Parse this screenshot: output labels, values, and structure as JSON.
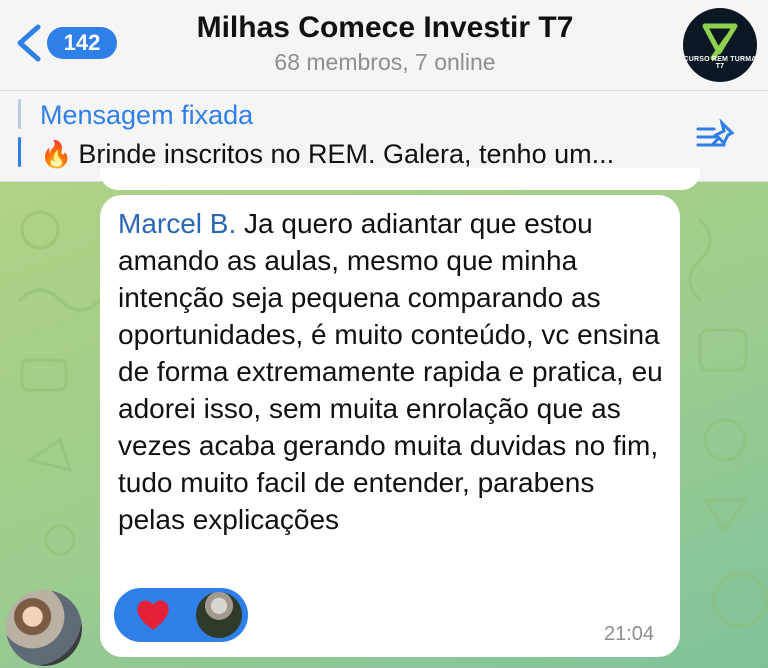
{
  "header": {
    "back_count": "142",
    "title": "Milhas Comece Investir T7",
    "subtitle": "68 membros, 7 online",
    "channel_avatar_text": "CURSO REM TURMA T7"
  },
  "pinned": {
    "label": "Mensagem fixada",
    "emoji": "🔥",
    "text": "Brinde inscritos no REM. Galera, tenho um..."
  },
  "message": {
    "author": "Marcel B.",
    "text": "Ja quero adiantar que estou amando as aulas, mesmo que minha intenção seja pequena comparando as oportunidades, é muito conteúdo, vc ensina de forma extremamente rapida e pratica, eu adorei isso, sem muita enrolação que as vezes acaba gerando muita duvidas no fim, tudo muito facil de entender, parabens pelas explicações",
    "time": "21:04",
    "reaction_icon": "heart-icon"
  },
  "colors": {
    "accent": "#2f7fe8",
    "author": "#2b67b5",
    "header_bg": "#f5f5f6"
  }
}
